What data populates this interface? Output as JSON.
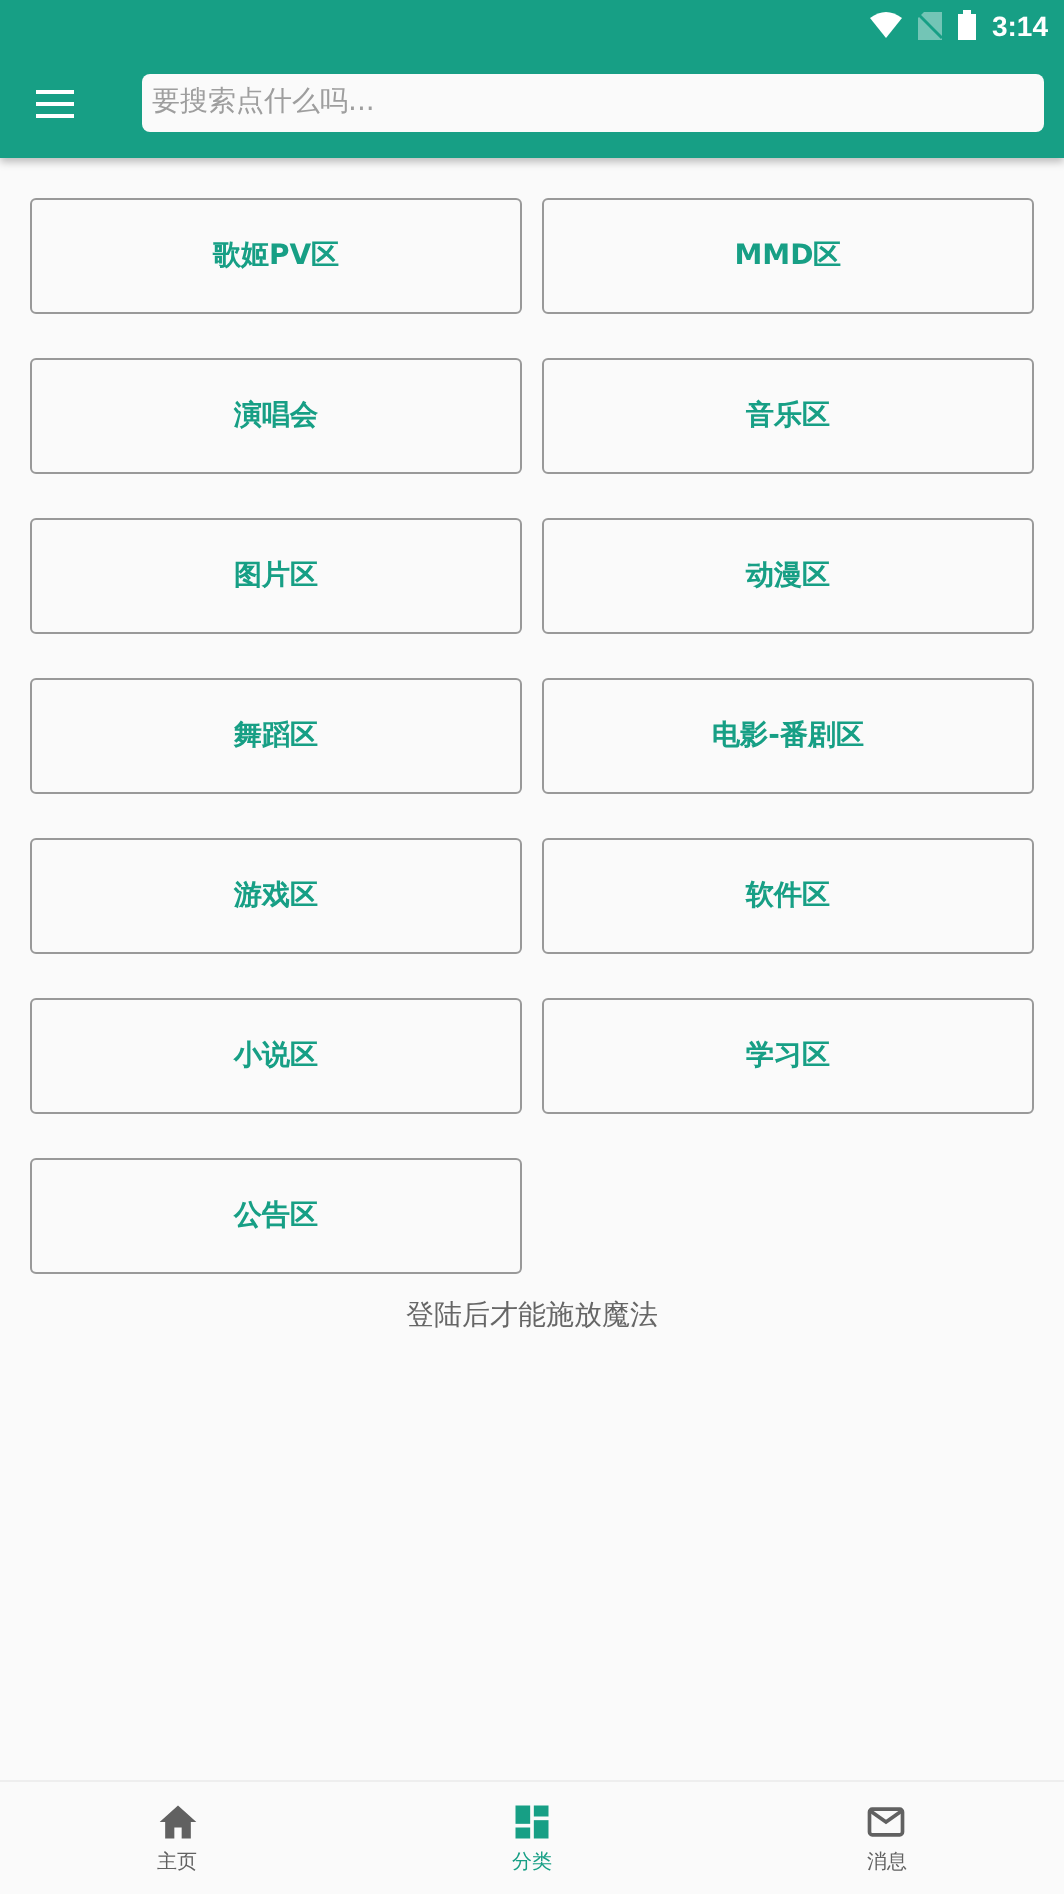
{
  "status_bar": {
    "time": "3:14"
  },
  "toolbar": {
    "search": {
      "placeholder": "要搜索点什么吗..."
    }
  },
  "categories": [
    {
      "label": "歌姬PV区"
    },
    {
      "label": "MMD区"
    },
    {
      "label": "演唱会"
    },
    {
      "label": "音乐区"
    },
    {
      "label": "图片区"
    },
    {
      "label": "动漫区"
    },
    {
      "label": "舞蹈区"
    },
    {
      "label": "电影-番剧区"
    },
    {
      "label": "游戏区"
    },
    {
      "label": "软件区"
    },
    {
      "label": "小说区"
    },
    {
      "label": "学习区"
    },
    {
      "label": "公告区"
    }
  ],
  "notice": "登陆后才能施放魔法",
  "bottom_nav": [
    {
      "label": "主页",
      "kind": "home",
      "selected": false
    },
    {
      "label": "分类",
      "kind": "grid",
      "selected": true
    },
    {
      "label": "消息",
      "kind": "mail",
      "selected": false
    }
  ]
}
